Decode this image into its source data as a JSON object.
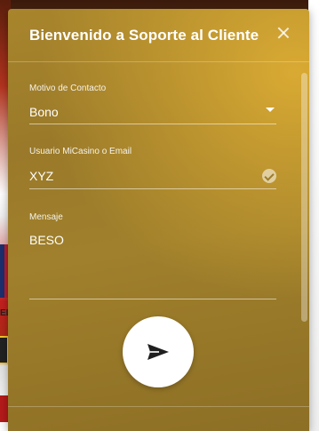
{
  "modal": {
    "title": "Bienvenido a Soporte al Cliente",
    "close_icon": "close-icon"
  },
  "form": {
    "contact_reason": {
      "label": "Motivo de Contacto",
      "value": "Bono",
      "icon": "chevron-down-icon"
    },
    "user": {
      "label": "Usuario MiCasino o Email",
      "value": "XYZ",
      "icon": "check-circle-icon"
    },
    "message": {
      "label": "Mensaje",
      "value": "BESO"
    },
    "send": {
      "icon": "send-icon"
    }
  },
  "background": {
    "strip_label": "EL"
  },
  "colors": {
    "panel_gold": "#a8852c",
    "text_white": "#ffffff"
  }
}
